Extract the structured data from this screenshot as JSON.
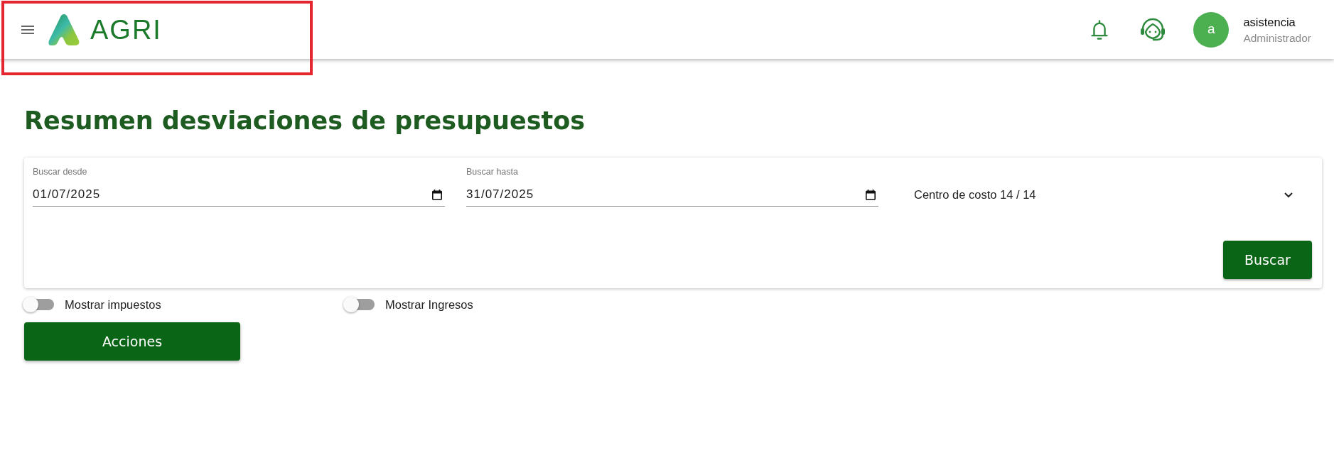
{
  "header": {
    "logo_text": "AGRI",
    "user": {
      "avatar_letter": "a",
      "name": "asistencia",
      "role": "Administrador"
    }
  },
  "title": "Resumen desviaciones de presupuestos",
  "filters": {
    "date_fields": [
      {
        "label": "Buscar desde",
        "value": "01/07/2025"
      },
      {
        "label": "Buscar hasta",
        "value": "31/07/2025"
      }
    ],
    "select": {
      "value": "Centro de costo 14 / 14"
    },
    "search_button": "Buscar"
  },
  "toggles": [
    {
      "label": "Mostrar impuestos",
      "on": false
    },
    {
      "label": "Mostrar Ingresos",
      "on": false
    }
  ],
  "actions_button": "Acciones"
}
